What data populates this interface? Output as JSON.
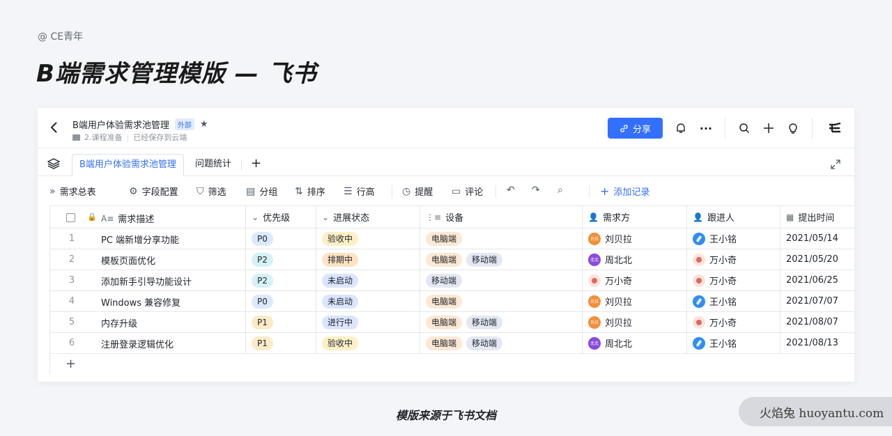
{
  "page": {
    "author": "@ CE青年",
    "headline": "B端需求管理模版 — 飞书",
    "caption": "模版来源于飞书文档",
    "watermark": "火焰兔 huoyantu.com"
  },
  "header": {
    "title": "B端用户体验需求池管理",
    "external_tag": "外部",
    "folder": "2.课程准备",
    "save_status": "已经保存到云端",
    "share_label": "分享",
    "accent": "#3370ff"
  },
  "tabs": [
    {
      "label": "B端用户体验需求池管理",
      "active": true
    },
    {
      "label": "问题统计",
      "active": false
    }
  ],
  "toolbar": {
    "view": "需求总表",
    "field_config": "字段配置",
    "filter": "筛选",
    "group": "分组",
    "sort": "排序",
    "row_height": "行高",
    "remind": "提醒",
    "comment": "评论",
    "add_record": "添加记录"
  },
  "table": {
    "columns": [
      "需求描述",
      "优先级",
      "进展状态",
      "设备",
      "需求方",
      "跟进人",
      "提出时间"
    ],
    "rows": [
      {
        "num": "1",
        "desc": "PC 端新增分享功能",
        "priority": "P0",
        "status": "验收中",
        "devices": [
          "电脑端"
        ],
        "requester": "刘贝拉",
        "follower": "王小铭",
        "date": "2021/05/14"
      },
      {
        "num": "2",
        "desc": "模板页面优化",
        "priority": "P2",
        "status": "排期中",
        "devices": [
          "电脑端",
          "移动端"
        ],
        "requester": "周北北",
        "follower": "万小奇",
        "date": "2021/05/20"
      },
      {
        "num": "3",
        "desc": "添加新手引导功能设计",
        "priority": "P2",
        "status": "未启动",
        "devices": [
          "移动端"
        ],
        "requester": "万小奇",
        "follower": "万小奇",
        "date": "2021/06/25"
      },
      {
        "num": "4",
        "desc": "Windows 兼容修复",
        "priority": "P0",
        "status": "未启动",
        "devices": [
          "电脑端"
        ],
        "requester": "刘贝拉",
        "follower": "王小铭",
        "date": "2021/07/07"
      },
      {
        "num": "5",
        "desc": "内存升级",
        "priority": "P1",
        "status": "进行中",
        "devices": [
          "电脑端",
          "移动端"
        ],
        "requester": "刘贝拉",
        "follower": "万小奇",
        "date": "2021/08/07"
      },
      {
        "num": "6",
        "desc": "注册登录逻辑优化",
        "priority": "P1",
        "status": "验收中",
        "devices": [
          "电脑端",
          "移动端"
        ],
        "requester": "周北北",
        "follower": "王小铭",
        "date": "2021/08/13"
      }
    ],
    "avatar_labels": {
      "刘贝拉": "贝拉",
      "周北北": "北北"
    }
  }
}
